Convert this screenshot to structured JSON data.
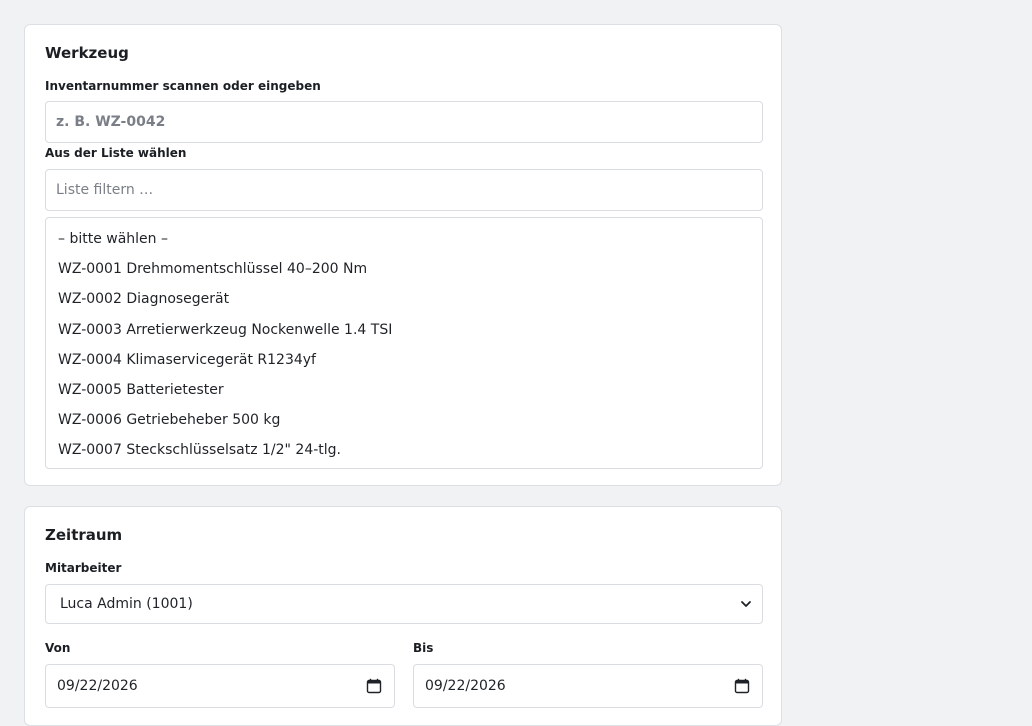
{
  "tool_section": {
    "title": "Werkzeug",
    "scan_label": "Inventarnummer scannen oder eingeben",
    "scan_placeholder": "z. B. WZ-0042",
    "list_label": "Aus der Liste wählen",
    "filter_placeholder": "Liste filtern …",
    "options": [
      "– bitte wählen –",
      "WZ-0001 Drehmomentschlüssel 40–200 Nm",
      "WZ-0002 Diagnosegerät",
      "WZ-0003 Arretierwerkzeug Nockenwelle 1.4 TSI",
      "WZ-0004 Klimaservicegerät R1234yf",
      "WZ-0005 Batterietester",
      "WZ-0006 Getriebeheber 500 kg",
      "WZ-0007 Steckschlüsselsatz 1/2\" 24-tlg."
    ]
  },
  "period_section": {
    "title": "Zeitraum",
    "employee_label": "Mitarbeiter",
    "employee_value": "Luca Admin (1001)",
    "from_label": "Von",
    "from_value": "09/22/2026",
    "to_label": "Bis",
    "to_value": "09/22/2026"
  },
  "icons": {
    "select_arrow": "chevron-down-icon",
    "date_picker": "calendar-icon"
  }
}
